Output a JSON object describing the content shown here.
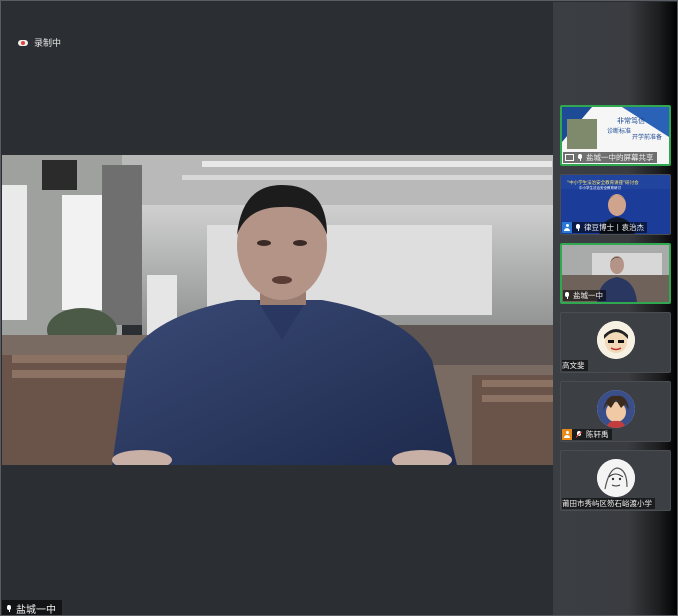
{
  "recording": {
    "label": "录制中"
  },
  "main_video": {
    "name": "盐城一中"
  },
  "participants": [
    {
      "name": "盐城一中的屏幕共享",
      "type": "screen"
    },
    {
      "name": "律豆博士丨袁治杰",
      "type": "video"
    },
    {
      "name": "盐城一中",
      "type": "video"
    },
    {
      "name": "高文斐",
      "type": "avatar"
    },
    {
      "name": "陈轩禹",
      "type": "avatar"
    },
    {
      "name": "莆田市秀屿区笏石峪渡小学",
      "type": "avatar"
    }
  ],
  "screen_share": {
    "slide_line1": "非常笃信",
    "slide_line2": "诊断标准",
    "slide_line3": "开学前准备"
  },
  "banner": {
    "title": "\"中小学生法治安全教育讲座\"研讨会",
    "subtitle": "中小学生法治安全教育研讨"
  },
  "colors": {
    "active_border": "#2fa84f",
    "background": "#2b2e32",
    "accent_blue": "#2878d8",
    "accent_orange": "#e88a1a"
  }
}
